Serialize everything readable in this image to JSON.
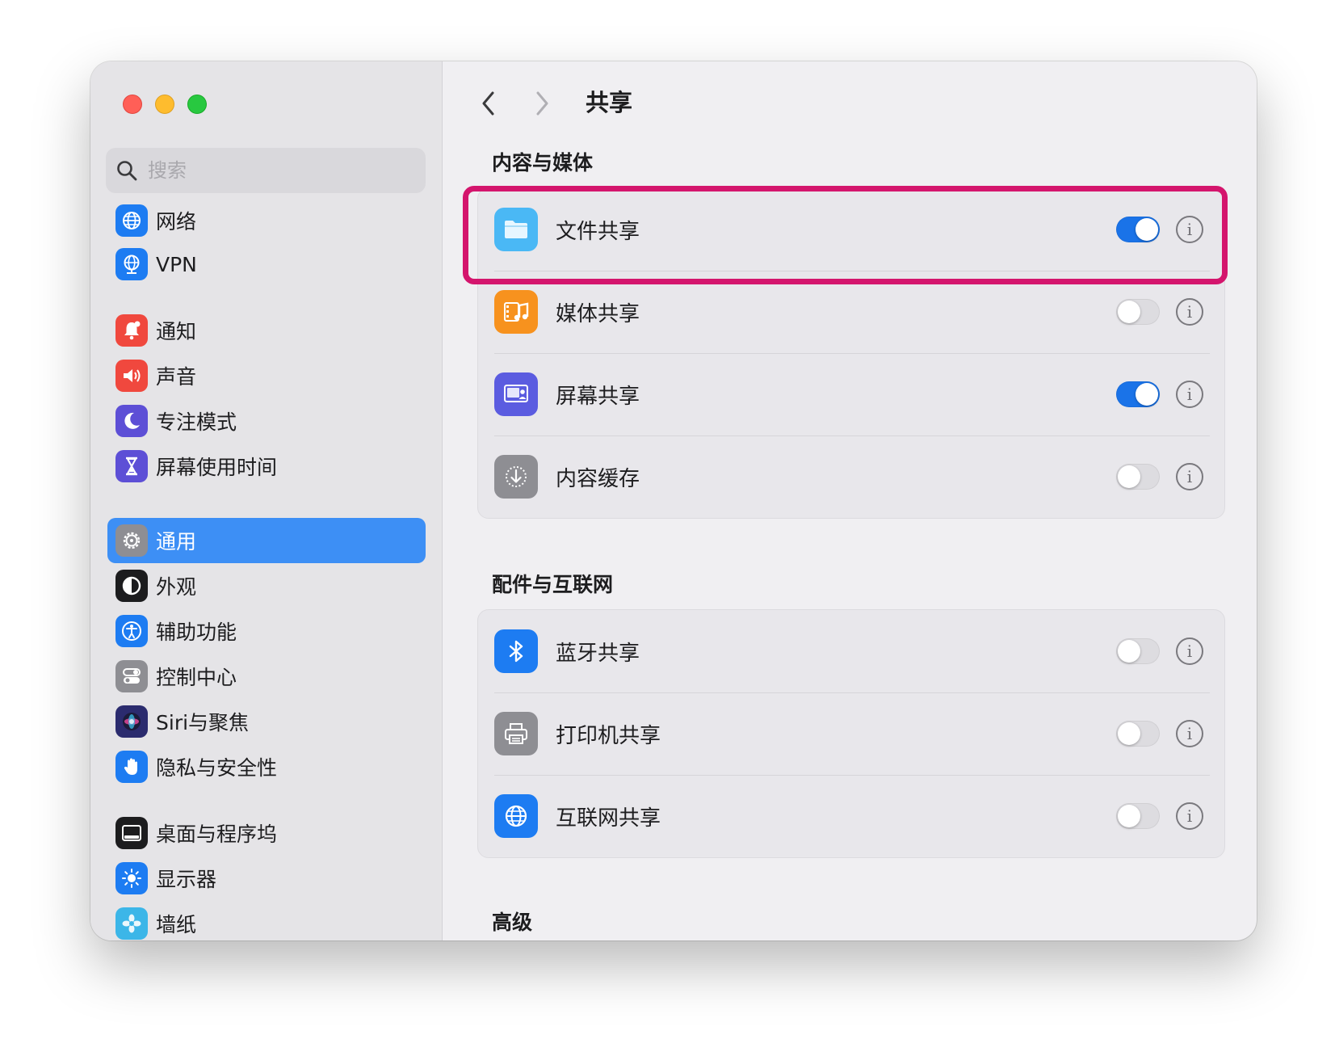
{
  "window": {
    "traffic_lights": [
      "close",
      "minimize",
      "zoom"
    ]
  },
  "sidebar": {
    "search_placeholder": "搜索",
    "items": [
      {
        "label": "网络",
        "icon": "globe-icon",
        "color": "#1d7cf2"
      },
      {
        "label": "VPN",
        "icon": "vpn-globe-icon",
        "color": "#1d7cf2"
      },
      {
        "label": "通知",
        "icon": "bell-icon",
        "color": "#f0483e"
      },
      {
        "label": "声音",
        "icon": "speaker-icon",
        "color": "#f0483e"
      },
      {
        "label": "专注模式",
        "icon": "moon-icon",
        "color": "#5d4fd6"
      },
      {
        "label": "屏幕使用时间",
        "icon": "hourglass-icon",
        "color": "#5d4fd6"
      },
      {
        "label": "通用",
        "icon": "gear-icon",
        "color": "#8e8e93",
        "selected": true
      },
      {
        "label": "外观",
        "icon": "appearance-icon",
        "color": "#1c1c1e"
      },
      {
        "label": "辅助功能",
        "icon": "accessibility-icon",
        "color": "#1d7cf2"
      },
      {
        "label": "控制中心",
        "icon": "toggles-icon",
        "color": "#8e8e93"
      },
      {
        "label": "Siri与聚焦",
        "icon": "siri-icon",
        "color": "#2b2b6e"
      },
      {
        "label": "隐私与安全性",
        "icon": "hand-icon",
        "color": "#1d7cf2"
      },
      {
        "label": "桌面与程序坞",
        "icon": "dock-icon",
        "color": "#1c1c1e"
      },
      {
        "label": "显示器",
        "icon": "sun-icon",
        "color": "#1d7cf2"
      },
      {
        "label": "墙纸",
        "icon": "flower-icon",
        "color": "#3cb6e8"
      }
    ]
  },
  "header": {
    "title": "共享",
    "back_icon": "chevron-left-icon",
    "forward_icon": "chevron-right-icon"
  },
  "sections": [
    {
      "title": "内容与媒体",
      "rows": [
        {
          "label": "文件共享",
          "icon": "folder-icon",
          "color": "#4ab8f5",
          "on": true,
          "highlighted": true
        },
        {
          "label": "媒体共享",
          "icon": "media-icon",
          "color": "#f7921e",
          "on": false
        },
        {
          "label": "屏幕共享",
          "icon": "screen-share-icon",
          "color": "#5b5ce0",
          "on": true
        },
        {
          "label": "内容缓存",
          "icon": "download-cache-icon",
          "color": "#8e8e93",
          "on": false
        }
      ]
    },
    {
      "title": "配件与互联网",
      "rows": [
        {
          "label": "蓝牙共享",
          "icon": "bluetooth-icon",
          "color": "#1d7cf2",
          "on": false
        },
        {
          "label": "打印机共享",
          "icon": "printer-icon",
          "color": "#8e8e93",
          "on": false
        },
        {
          "label": "互联网共享",
          "icon": "globe-icon",
          "color": "#1d7cf2",
          "on": false
        }
      ]
    },
    {
      "title": "高级",
      "rows": []
    }
  ],
  "info_glyph": "i",
  "highlight_color": "#d4156d"
}
